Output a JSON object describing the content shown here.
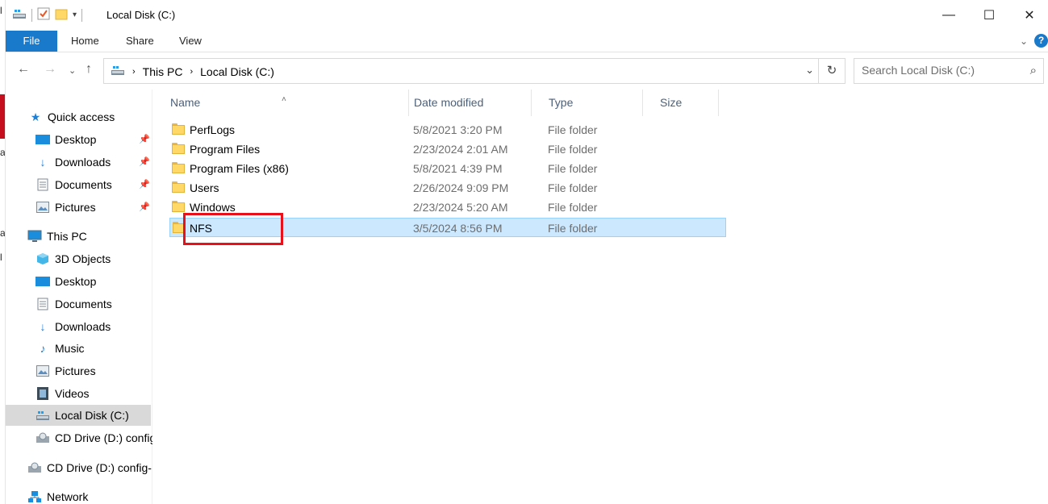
{
  "window": {
    "title": "Local Disk (C:)",
    "controls": {
      "minimize": "—",
      "maximize": "☐",
      "close": "✕"
    }
  },
  "ribbon": {
    "tabs": [
      "File",
      "Home",
      "Share",
      "View"
    ]
  },
  "address_bar": {
    "crumbs": [
      "This PC",
      "Local Disk (C:)"
    ]
  },
  "search": {
    "placeholder": "Search Local Disk (C:)"
  },
  "nav_pane": {
    "items": [
      {
        "label": "Quick access",
        "icon": "star-icon"
      },
      {
        "label": "Desktop",
        "icon": "desktop-icon",
        "pinned": true
      },
      {
        "label": "Downloads",
        "icon": "download-arrow-icon",
        "pinned": true
      },
      {
        "label": "Documents",
        "icon": "documents-icon",
        "pinned": true
      },
      {
        "label": "Pictures",
        "icon": "pictures-icon",
        "pinned": true
      },
      {
        "label": "This PC",
        "icon": "computer-icon"
      },
      {
        "label": "3D Objects",
        "icon": "cube-icon"
      },
      {
        "label": "Desktop",
        "icon": "desktop-icon"
      },
      {
        "label": "Documents",
        "icon": "documents-icon"
      },
      {
        "label": "Downloads",
        "icon": "download-arrow-icon"
      },
      {
        "label": "Music",
        "icon": "music-note-icon"
      },
      {
        "label": "Pictures",
        "icon": "pictures-icon"
      },
      {
        "label": "Videos",
        "icon": "film-icon"
      },
      {
        "label": "Local Disk (C:)",
        "icon": "drive-icon",
        "selected": true
      },
      {
        "label": "CD Drive (D:) config",
        "icon": "cd-drive-icon"
      },
      {
        "label": "CD Drive (D:) config-.",
        "icon": "cd-drive-icon"
      },
      {
        "label": "Network",
        "icon": "network-icon"
      }
    ]
  },
  "file_list": {
    "columns": [
      "Name",
      "Date modified",
      "Type",
      "Size"
    ],
    "rows": [
      {
        "name": "PerfLogs",
        "date": "5/8/2021 3:20 PM",
        "type": "File folder",
        "size": ""
      },
      {
        "name": "Program Files",
        "date": "2/23/2024 2:01 AM",
        "type": "File folder",
        "size": ""
      },
      {
        "name": "Program Files (x86)",
        "date": "5/8/2021 4:39 PM",
        "type": "File folder",
        "size": ""
      },
      {
        "name": "Users",
        "date": "2/26/2024 9:09 PM",
        "type": "File folder",
        "size": ""
      },
      {
        "name": "Windows",
        "date": "2/23/2024 5:20 AM",
        "type": "File folder",
        "size": ""
      },
      {
        "name": "NFS",
        "date": "3/5/2024 8:56 PM",
        "type": "File folder",
        "size": "",
        "selected": true
      }
    ]
  },
  "colors": {
    "accent": "#1979ca",
    "selection": "#cce8ff",
    "annotation": "#e8101a"
  }
}
